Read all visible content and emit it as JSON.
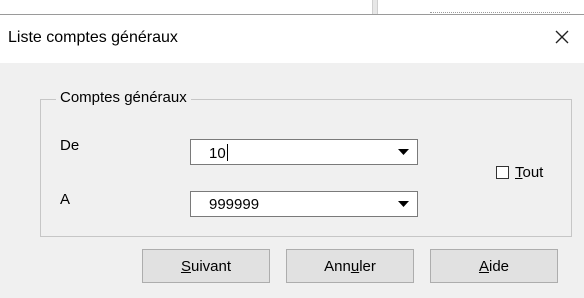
{
  "dialog": {
    "title": "Liste comptes généraux"
  },
  "group": {
    "legend": "Comptes généraux"
  },
  "from": {
    "label": "De",
    "value": "10"
  },
  "to": {
    "label": "A",
    "value": "999999"
  },
  "all_checkbox": {
    "label_mnemonic": "T",
    "label_rest": "out",
    "checked": false
  },
  "buttons": {
    "next": {
      "mnemonic": "S",
      "rest": "uivant"
    },
    "cancel": {
      "pre": "Ann",
      "mnemonic": "u",
      "post": "ler"
    },
    "help": {
      "mnemonic": "A",
      "rest": "ide"
    }
  }
}
